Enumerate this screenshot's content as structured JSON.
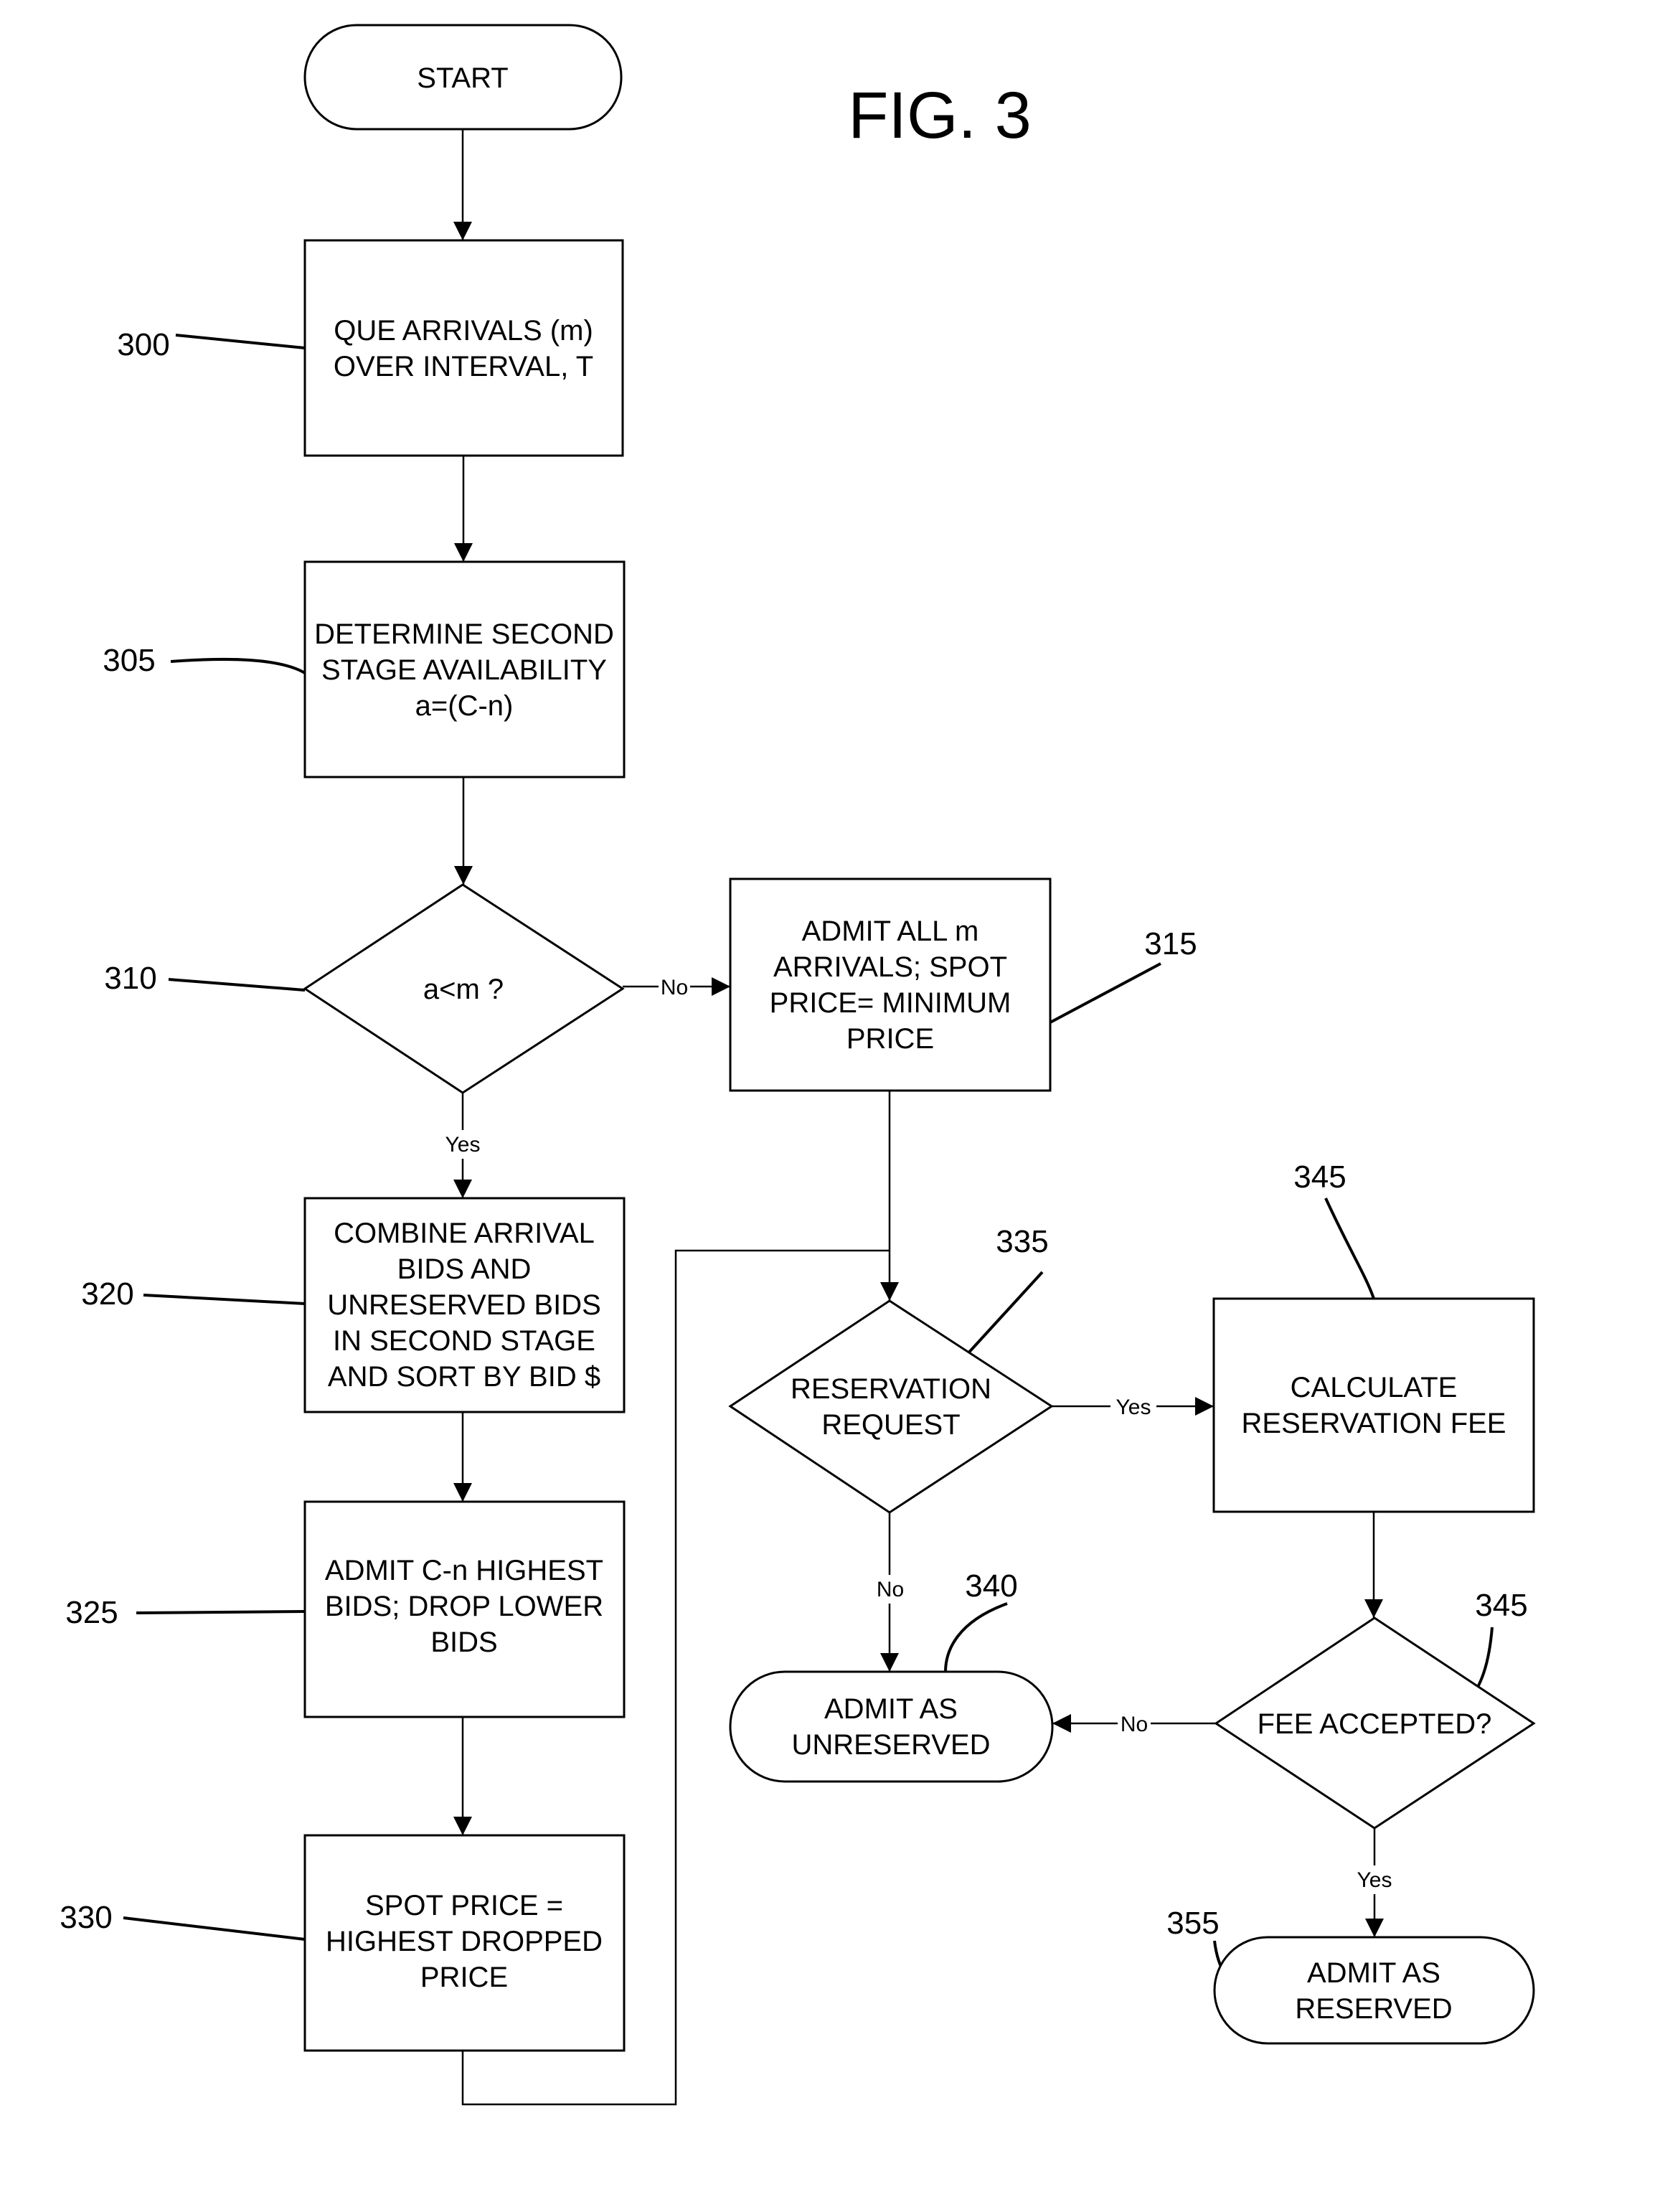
{
  "figure": {
    "title": "FIG. 3",
    "colors": {
      "ink": "#000000",
      "paper": "#ffffff"
    }
  },
  "nodes": {
    "start": {
      "type": "terminal",
      "lines": [
        "START"
      ]
    },
    "n300": {
      "type": "process",
      "ref": "300",
      "lines": [
        "QUE ARRIVALS (m)",
        "OVER INTERVAL, T"
      ]
    },
    "n305": {
      "type": "process",
      "ref": "305",
      "lines": [
        "DETERMINE SECOND",
        "STAGE AVAILABILITY",
        "a=(C-n)"
      ]
    },
    "n310": {
      "type": "decision",
      "ref": "310",
      "lines": [
        "a<m ?"
      ]
    },
    "n315": {
      "type": "process",
      "ref": "315",
      "lines": [
        "ADMIT ALL m",
        "ARRIVALS;  SPOT",
        "PRICE= MINIMUM",
        "PRICE"
      ]
    },
    "n320": {
      "type": "process",
      "ref": "320",
      "lines": [
        "COMBINE ARRIVAL",
        "BIDS AND",
        "UNRESERVED  BIDS",
        "IN SECOND STAGE",
        "AND SORT BY BID $"
      ]
    },
    "n325": {
      "type": "process",
      "ref": "325",
      "lines": [
        "ADMIT C-n HIGHEST",
        "BIDS; DROP LOWER",
        "BIDS"
      ]
    },
    "n330": {
      "type": "process",
      "ref": "330",
      "lines": [
        "SPOT PRICE =",
        "HIGHEST DROPPED",
        "PRICE"
      ]
    },
    "n335": {
      "type": "decision",
      "ref": "335",
      "lines": [
        "RESERVATION",
        "REQUEST"
      ]
    },
    "n340": {
      "type": "terminal",
      "ref": "340",
      "lines": [
        "ADMIT AS",
        "UNRESERVED"
      ]
    },
    "n345a": {
      "type": "process",
      "ref": "345",
      "lines": [
        "CALCULATE",
        "RESERVATION FEE"
      ]
    },
    "n345b": {
      "type": "decision",
      "ref": "345",
      "lines": [
        "FEE ACCEPTED?"
      ]
    },
    "n355": {
      "type": "terminal",
      "ref": "355",
      "lines": [
        "ADMIT AS",
        "RESERVED"
      ]
    }
  },
  "edges": [
    {
      "from": "start",
      "to": "n300",
      "label": ""
    },
    {
      "from": "n300",
      "to": "n305",
      "label": ""
    },
    {
      "from": "n305",
      "to": "n310",
      "label": ""
    },
    {
      "from": "n310",
      "to": "n315",
      "label": "No"
    },
    {
      "from": "n310",
      "to": "n320",
      "label": "Yes"
    },
    {
      "from": "n320",
      "to": "n325",
      "label": ""
    },
    {
      "from": "n325",
      "to": "n330",
      "label": ""
    },
    {
      "from": "n330",
      "to": "n335",
      "label": ""
    },
    {
      "from": "n315",
      "to": "n335",
      "label": ""
    },
    {
      "from": "n335",
      "to": "n345a",
      "label": "Yes"
    },
    {
      "from": "n335",
      "to": "n340",
      "label": "No"
    },
    {
      "from": "n345a",
      "to": "n345b",
      "label": ""
    },
    {
      "from": "n345b",
      "to": "n340",
      "label": "No"
    },
    {
      "from": "n345b",
      "to": "n355",
      "label": "Yes"
    }
  ]
}
